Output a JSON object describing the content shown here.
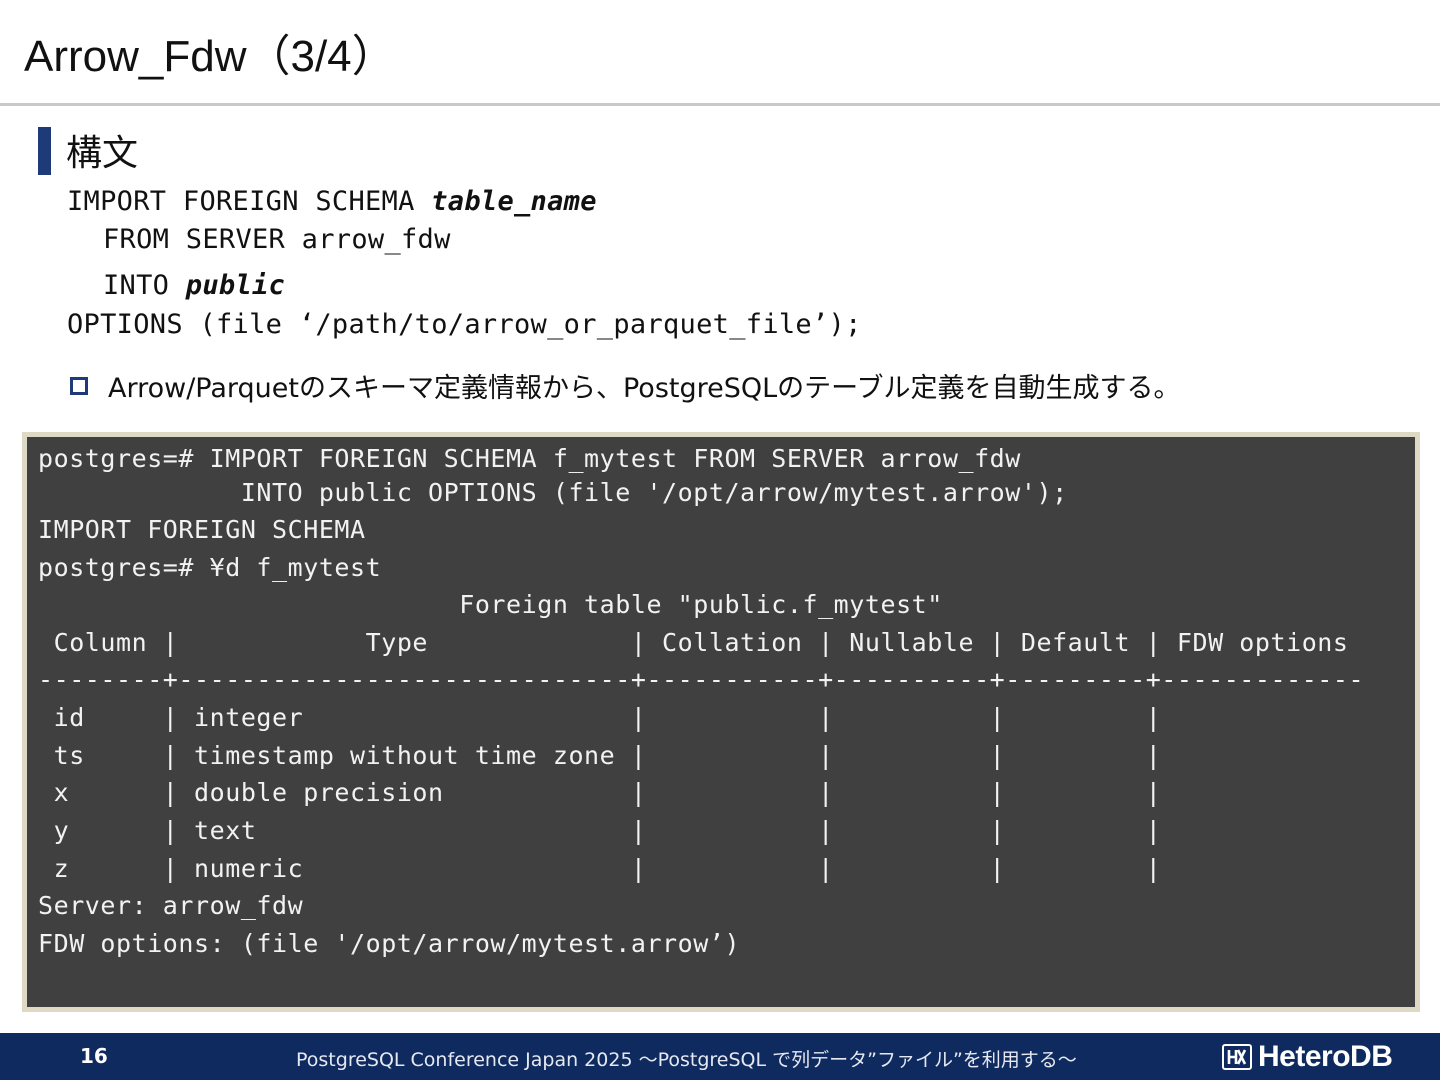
{
  "title": "Arrow_Fdw（3/4）",
  "section_heading": "構文",
  "syntax": {
    "line1_prefix": "IMPORT FOREIGN SCHEMA ",
    "line1_param": "table_name",
    "line2": "FROM SERVER arrow_fdw",
    "line3_prefix": "INTO ",
    "line3_param": "public",
    "line4": "OPTIONS (file ‘/path/to/arrow_or_parquet_file’);"
  },
  "bullet": "Arrow/Parquetのスキーマ定義情報から、PostgreSQLのテーブル定義を自動生成する。",
  "terminal_lines": [
    "postgres=# IMPORT FOREIGN SCHEMA f_mytest FROM SERVER arrow_fdw",
    "             INTO public OPTIONS (file '/opt/arrow/mytest.arrow');",
    "IMPORT FOREIGN SCHEMA",
    "postgres=# ¥d f_mytest",
    "                           Foreign table \"public.f_mytest\"",
    " Column |            Type             | Collation | Nullable | Default | FDW options",
    "--------+-----------------------------+-----------+----------+---------+-------------",
    " id     | integer                     |           |          |         |",
    " ts     | timestamp without time zone |           |          |         |",
    " x      | double precision            |           |          |         |",
    " y      | text                        |           |          |         |",
    " z      | numeric                     |           |          |         |",
    "Server: arrow_fdw",
    "FDW options: (file '/opt/arrow/mytest.arrow’)"
  ],
  "footer": {
    "page_number": "16",
    "text": "PostgreSQL Conference Japan 2025 〜PostgreSQL で列データ”ファイル”を利用する〜",
    "logo_text": "HeteroDB",
    "logo_icon": "heterodb-logo-icon"
  },
  "colors": {
    "accent": "#1e3a78",
    "footer_bg": "#0e2a5e",
    "terminal_bg": "#404040",
    "terminal_border": "#ddd9c4"
  }
}
